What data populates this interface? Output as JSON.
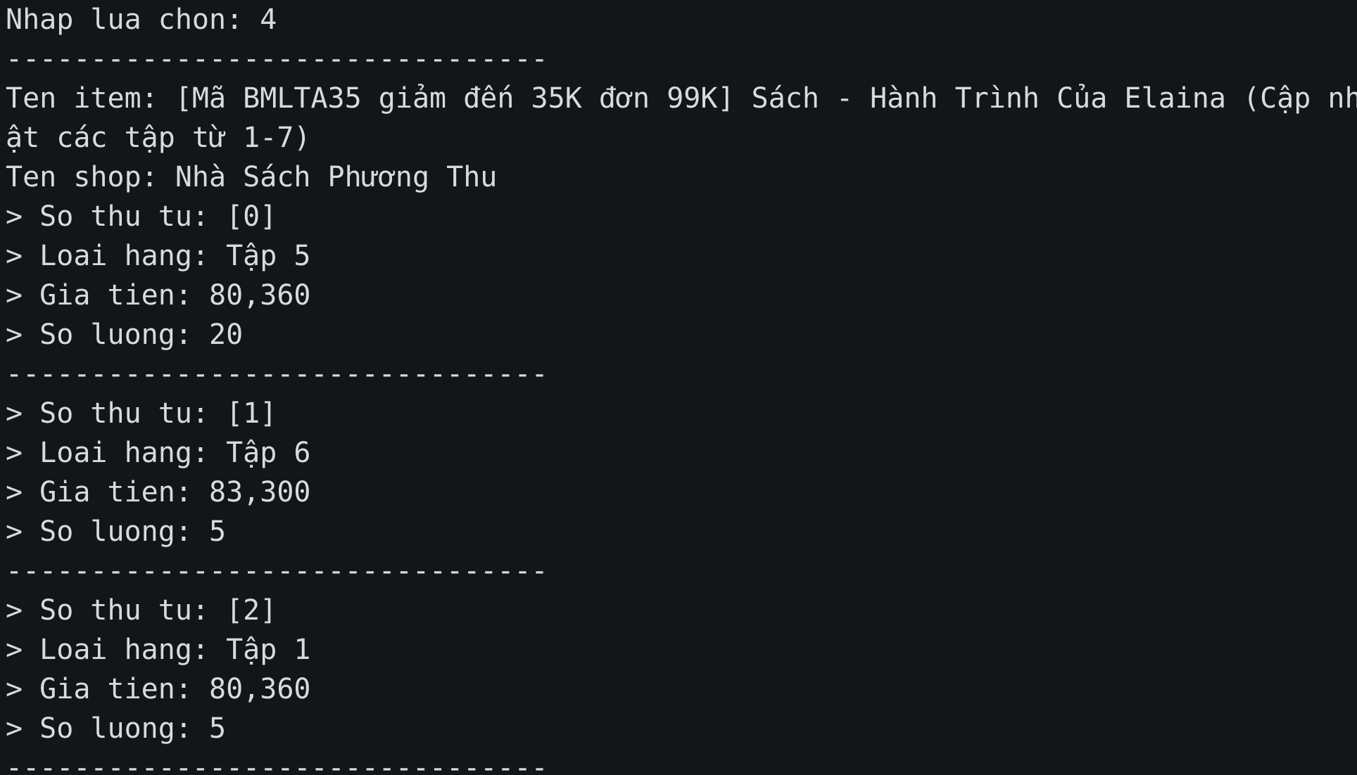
{
  "terminal": {
    "prompt_line": "Nhap lua chon: 4",
    "separator": "--------------------------------",
    "item_line_1": "Ten item: [Mã BMLTA35 giảm đến 35K đơn 99K] Sách - Hành Trình Của Elaina (Cập nh",
    "item_line_2": "ật các tập từ 1-7)",
    "shop_line": "Ten shop: Nhà Sách Phương Thu",
    "variants": [
      {
        "index_line": "> So thu tu: [0]",
        "type_line": "> Loai hang: Tập 5",
        "price_line": "> Gia tien: 80,360",
        "qty_line": "> So luong: 20"
      },
      {
        "index_line": "> So thu tu: [1]",
        "type_line": "> Loai hang: Tập 6",
        "price_line": "> Gia tien: 83,300",
        "qty_line": "> So luong: 5"
      },
      {
        "index_line": "> So thu tu: [2]",
        "type_line": "> Loai hang: Tập 1",
        "price_line": "> Gia tien: 80,360",
        "qty_line": "> So luong: 5"
      }
    ]
  }
}
